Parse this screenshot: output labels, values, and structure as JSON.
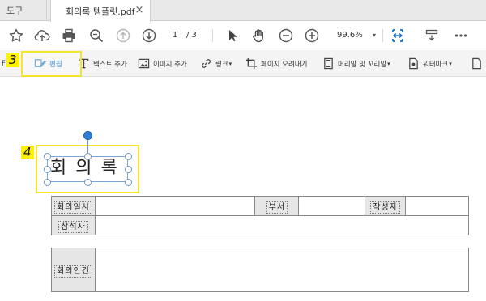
{
  "tabs": {
    "tools_label": "도구",
    "document_label": "회의록 템플릿.pdf",
    "close_symbol": "×"
  },
  "toolbar": {
    "page_current": "1",
    "page_total": "/ 3",
    "zoom": "99.6%",
    "icons": [
      "star-icon",
      "cloud-upload-icon",
      "print-icon",
      "zoom-search-icon",
      "page-up-icon",
      "page-down-icon",
      "pointer-icon",
      "hand-icon",
      "zoom-out-icon",
      "zoom-in-icon",
      "fit-page-icon",
      "scroll-mode-icon",
      "more-icon"
    ]
  },
  "edit_toolbar": {
    "partial_label": "F :",
    "edit": "편집",
    "add_text": "텍스트 추가",
    "add_image": "이미지 추가",
    "link": "링크",
    "crop": "페이지 오려내기",
    "header_footer": "머리말 및 꼬리말",
    "watermark": "워터마크"
  },
  "badges": {
    "step3": "3",
    "step4": "4"
  },
  "document": {
    "title": "회의록",
    "table": {
      "date_label": "회의일시",
      "dept_label": "부서",
      "author_label": "작성자",
      "attendees_label": "참석자",
      "agenda_label": "회의안건"
    }
  },
  "colors": {
    "accent": "#1a73c9",
    "highlight": "#f5e52a",
    "badge": "#fff200",
    "selection": "#6f98c9"
  }
}
